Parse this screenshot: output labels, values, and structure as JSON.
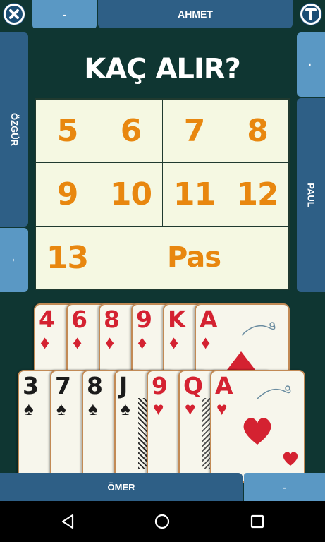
{
  "players": {
    "top_name": "AHMET",
    "top_bid": "-",
    "left_name": "ÖZGÜR",
    "left_bid": "-",
    "right_name": "PAUL",
    "right_bid": "-",
    "bottom_name": "ÖMER",
    "bottom_bid": "-"
  },
  "bid_prompt": "KAÇ ALIR?",
  "bid_options": [
    "5",
    "6",
    "7",
    "8",
    "9",
    "10",
    "11",
    "12",
    "13",
    "Pas"
  ],
  "hand_top_row": [
    {
      "rank": "4",
      "suit": "♦",
      "color": "red"
    },
    {
      "rank": "6",
      "suit": "♦",
      "color": "red"
    },
    {
      "rank": "8",
      "suit": "♦",
      "color": "red"
    },
    {
      "rank": "9",
      "suit": "♦",
      "color": "red"
    },
    {
      "rank": "K",
      "suit": "♦",
      "color": "red"
    },
    {
      "rank": "A",
      "suit": "♦",
      "color": "red"
    }
  ],
  "hand_bottom_row": [
    {
      "rank": "3",
      "suit": "♠",
      "color": "black"
    },
    {
      "rank": "7",
      "suit": "♠",
      "color": "black"
    },
    {
      "rank": "8",
      "suit": "♠",
      "color": "black"
    },
    {
      "rank": "J",
      "suit": "♠",
      "color": "black"
    },
    {
      "rank": "9",
      "suit": "♥",
      "color": "red"
    },
    {
      "rank": "Q",
      "suit": "♥",
      "color": "red"
    },
    {
      "rank": "A",
      "suit": "♥",
      "color": "red"
    }
  ],
  "icons": {
    "close": "close-icon",
    "info": "t-icon",
    "back": "back-icon",
    "home": "home-icon",
    "recents": "recents-icon"
  },
  "colors": {
    "background": "#0f3632",
    "panel": "#2e5f86",
    "panel_light": "#5a98c4",
    "bid_text": "#e8870f",
    "red_suit": "#d42231"
  }
}
